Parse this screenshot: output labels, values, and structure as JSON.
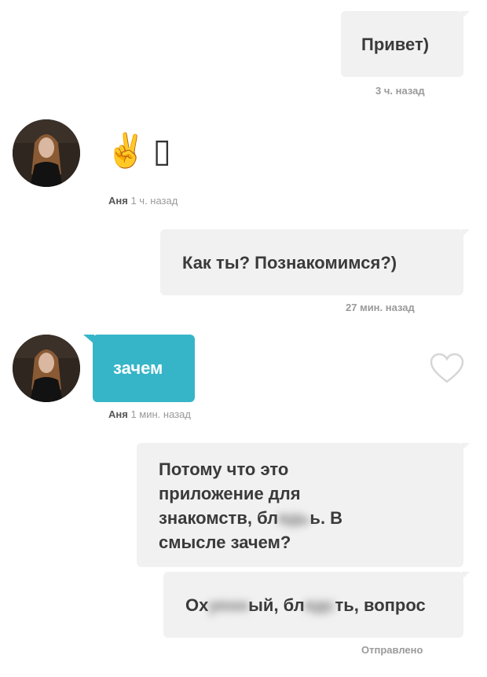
{
  "messages": {
    "m1": {
      "text": "Привет)",
      "time": "3 ч. назад"
    },
    "m2": {
      "author": "Аня",
      "time": "1 ч. назад",
      "emoji": "✌️",
      "missing_glyph": "▯"
    },
    "m3": {
      "text": "Как ты? Познакомимся?)",
      "time": "27 мин. назад"
    },
    "m4": {
      "text": "зачем",
      "author": "Аня",
      "time": "1 мин. назад"
    },
    "m5": {
      "line1": "Потому что это",
      "line2": "приложение для",
      "line3_before": "знакомств, бл",
      "line3_censored": "ядь",
      "line3_after": "ь. В",
      "line4": "смысле зачем?"
    },
    "m6": {
      "part1": "Ох",
      "censored1": "уенн",
      "part2": "ый, бл",
      "censored2": "ядс",
      "part3": "ть, вопрос",
      "status": "Отправлено"
    }
  },
  "colors": {
    "accent": "#36b5c8",
    "bubble": "#f1f1f1"
  },
  "icons": {
    "like": "heart-outline-icon"
  }
}
